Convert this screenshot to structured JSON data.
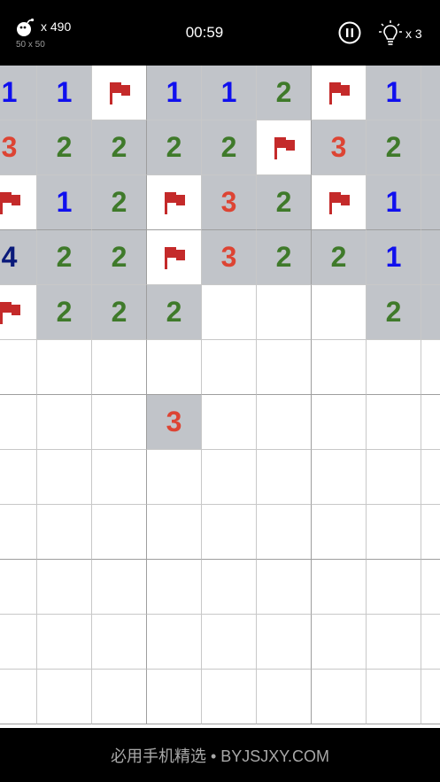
{
  "header": {
    "bomb_icon": "bomb-icon",
    "bomb_count": "x 490",
    "board_size": "50 x 50",
    "timer": "00:59",
    "pause_icon": "pause-icon",
    "hint_icon": "lightbulb-icon",
    "hint_count": "x 3"
  },
  "colors": {
    "revealed_cell": "#c1c4c9",
    "hidden_cell": "#ffffff",
    "grid_line": "#c8c8c8",
    "block_line": "#9e9e9e",
    "flag": "#c42a2a",
    "number_1": "#1010ee",
    "number_2": "#3f7a2a",
    "number_3": "#dd4433",
    "number_4": "#0a1a7a"
  },
  "board": {
    "cols": 9,
    "rows": 12,
    "cells": [
      [
        "1",
        "1",
        "F",
        "1",
        "1",
        "2",
        "F",
        "1",
        "R"
      ],
      [
        "3",
        "2",
        "2",
        "2",
        "2",
        "F",
        "3",
        "2",
        "R"
      ],
      [
        "F",
        "1",
        "2",
        "F",
        "3",
        "2",
        "F",
        "1",
        "R"
      ],
      [
        "4",
        "2",
        "2",
        "F",
        "3",
        "2",
        "2",
        "1",
        "R"
      ],
      [
        "F",
        "2",
        "2",
        "2",
        "H",
        "H",
        "H",
        "2",
        "R"
      ],
      [
        "H",
        "H",
        "H",
        "H",
        "H",
        "H",
        "H",
        "H",
        "H"
      ],
      [
        "H",
        "H",
        "H",
        "3",
        "H",
        "H",
        "H",
        "H",
        "H"
      ],
      [
        "H",
        "H",
        "H",
        "H",
        "H",
        "H",
        "H",
        "H",
        "H"
      ],
      [
        "H",
        "H",
        "H",
        "H",
        "H",
        "H",
        "H",
        "H",
        "H"
      ],
      [
        "H",
        "H",
        "H",
        "H",
        "H",
        "H",
        "H",
        "H",
        "H"
      ],
      [
        "H",
        "H",
        "H",
        "H",
        "H",
        "H",
        "H",
        "H",
        "H"
      ],
      [
        "H",
        "H",
        "H",
        "H",
        "H",
        "H",
        "H",
        "H",
        "H"
      ]
    ]
  },
  "footer": {
    "text": "必用手机精选 • BYJSJXY.COM"
  }
}
